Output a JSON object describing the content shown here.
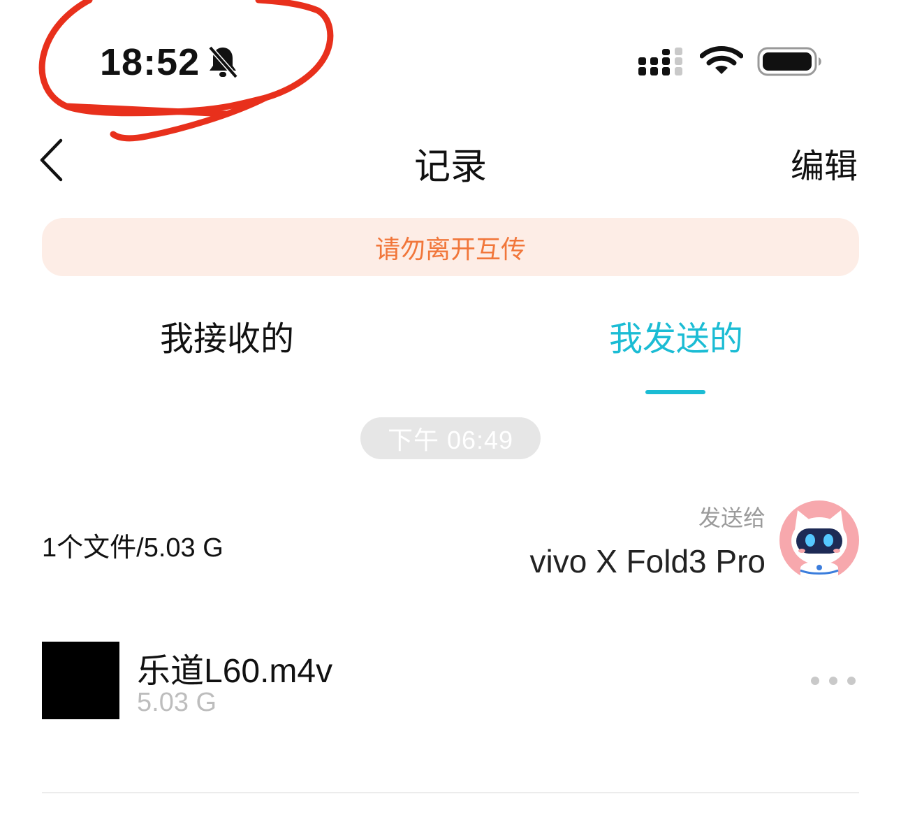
{
  "status_bar": {
    "time": "18:52",
    "bell_icon": "bell-slash-icon"
  },
  "nav": {
    "title": "记录",
    "edit_label": "编辑"
  },
  "banner": {
    "text": "请勿离开互传",
    "bg_color": "#fdede6",
    "text_color": "#f1763a"
  },
  "tabs": [
    {
      "label": "我接收的",
      "active": false
    },
    {
      "label": "我发送的",
      "active": true
    }
  ],
  "accent_color": "#1bbcd4",
  "record": {
    "time": "下午 06:49",
    "summary": "1个文件/5.03 G",
    "send_to_label": "发送给",
    "device_name": "vivo X Fold3 Pro",
    "files": [
      {
        "name": "乐道L60.m4v",
        "size": "5.03 G"
      }
    ]
  },
  "annotation_color": "#e8301c"
}
